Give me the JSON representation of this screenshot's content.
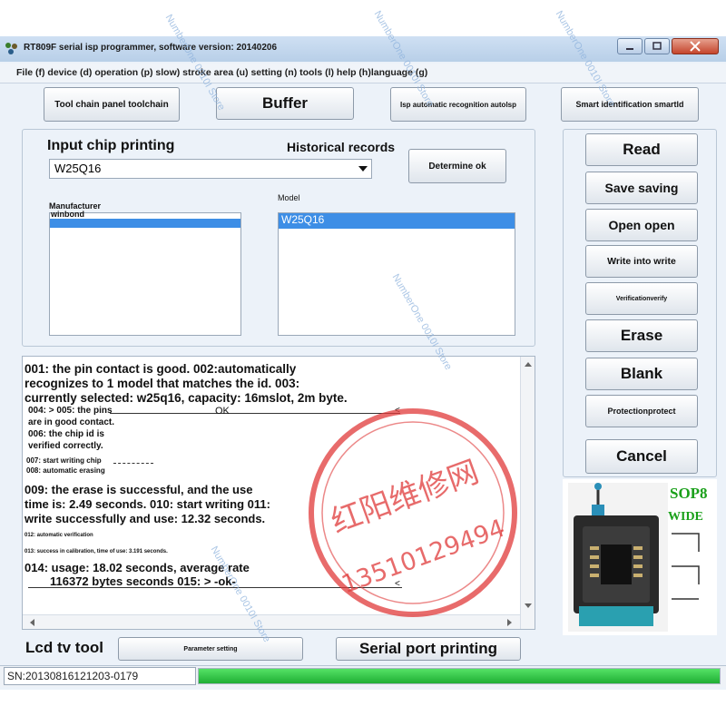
{
  "window": {
    "title": "RT809F serial isp programmer, software version: 20140206"
  },
  "menu": {
    "text": "File (f) device (d) operation (p) slow) stroke area (u) setting (n) tools (l) help (h)language (g)"
  },
  "toolbar": {
    "toolchain": "Tool chain panel toolchain",
    "buffer": "Buffer",
    "autoisp": "Isp automatic recognition autolsp",
    "smartid": "Smart identification smartld"
  },
  "chip": {
    "input_label": "Input chip printing",
    "history_label": "Historical records",
    "selected": "W25Q16",
    "determine": "Determine ok",
    "manufacturer_label": "Manufacturer",
    "manufacturer_selected": "winbond",
    "model_label": "Model",
    "model_selected": "W25Q16"
  },
  "actions": {
    "read": "Read",
    "save": "Save saving",
    "open": "Open open",
    "write": "Write into write",
    "verify": "Verificationverify",
    "erase": "Erase",
    "blank": "Blank",
    "protect": "Protectionprotect",
    "cancel": "Cancel"
  },
  "log": {
    "l1": "001: the pin contact is good. 002:automatically",
    "l2": "recognizes to 1 model that matches the id. 003:",
    "l3": "currently selected: w25q16, capacity: 16mslot, 2m byte.",
    "l4": "004: > 005: the pins",
    "l4b": "OK",
    "l4c": "<",
    "l5": "are in good contact.",
    "l6": "006: the chip id is",
    "l7": "verified correctly.",
    "l8": "007: start writing chip",
    "l9": "008: automatic erasing",
    "l10": "009: the erase is successful, and the use",
    "l11": "time is: 2.49 seconds. 010: start writing 011:",
    "l12": "write successfully and use: 12.32 seconds.",
    "l13": "012: automatic verification",
    "l14": "013: success in calibration, time of use: 3.191 seconds.",
    "l15": "014: usage: 18.02 seconds, average rate",
    "l16": "116372 bytes seconds 015: > -ok-",
    "l16b": "<"
  },
  "bottom": {
    "lcd": "Lcd tv tool",
    "param": "Parameter setting",
    "serial": "Serial port printing"
  },
  "status": {
    "sn": "SN:20130816121203-0179",
    "progress_percent": 100
  },
  "chip_image": {
    "label1": "SOP8",
    "label2": "WIDE"
  },
  "stamp": {
    "text_top": "红阳维修网",
    "text_bottom": "13510129494"
  },
  "watermark": {
    "text": "NumberOne 0010I Store"
  },
  "colors": {
    "progress": "#2fc446",
    "selection": "#3d8ee6",
    "stamp": "#e03a3a",
    "chip_green": "#1aa01a"
  }
}
